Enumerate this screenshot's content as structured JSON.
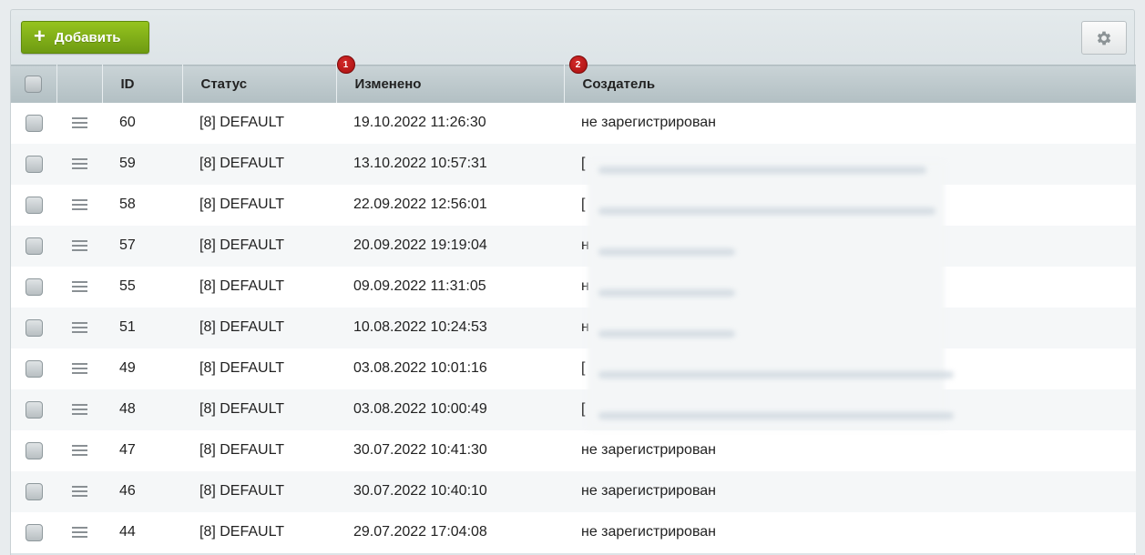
{
  "toolbar": {
    "add_label": "Добавить",
    "add_icon": "plus-icon",
    "settings_icon": "gear-icon"
  },
  "columns": [
    {
      "key": "check",
      "label": ""
    },
    {
      "key": "menu",
      "label": ""
    },
    {
      "key": "id",
      "label": "ID"
    },
    {
      "key": "status",
      "label": "Статус"
    },
    {
      "key": "modified",
      "label": "Изменено",
      "badge": "1"
    },
    {
      "key": "creator",
      "label": "Создатель",
      "badge": "2"
    }
  ],
  "rows": [
    {
      "id": "60",
      "status": "[8] DEFAULT",
      "modified": "19.10.2022 11:26:30",
      "creator": "не зарегистрирован"
    },
    {
      "id": "59",
      "status": "[8] DEFAULT",
      "modified": "13.10.2022 10:57:31",
      "creator": "["
    },
    {
      "id": "58",
      "status": "[8] DEFAULT",
      "modified": "22.09.2022 12:56:01",
      "creator": "["
    },
    {
      "id": "57",
      "status": "[8] DEFAULT",
      "modified": "20.09.2022 19:19:04",
      "creator": "н"
    },
    {
      "id": "55",
      "status": "[8] DEFAULT",
      "modified": "09.09.2022 11:31:05",
      "creator": "н"
    },
    {
      "id": "51",
      "status": "[8] DEFAULT",
      "modified": "10.08.2022 10:24:53",
      "creator": "н"
    },
    {
      "id": "49",
      "status": "[8] DEFAULT",
      "modified": "03.08.2022 10:01:16",
      "creator": "["
    },
    {
      "id": "48",
      "status": "[8] DEFAULT",
      "modified": "03.08.2022 10:00:49",
      "creator": "["
    },
    {
      "id": "47",
      "status": "[8] DEFAULT",
      "modified": "30.07.2022 10:41:30",
      "creator": "не зарегистрирован"
    },
    {
      "id": "46",
      "status": "[8] DEFAULT",
      "modified": "30.07.2022 10:40:10",
      "creator": "не зарегистрирован"
    },
    {
      "id": "44",
      "status": "[8] DEFAULT",
      "modified": "29.07.2022 17:04:08",
      "creator": "не зарегистрирован"
    }
  ]
}
